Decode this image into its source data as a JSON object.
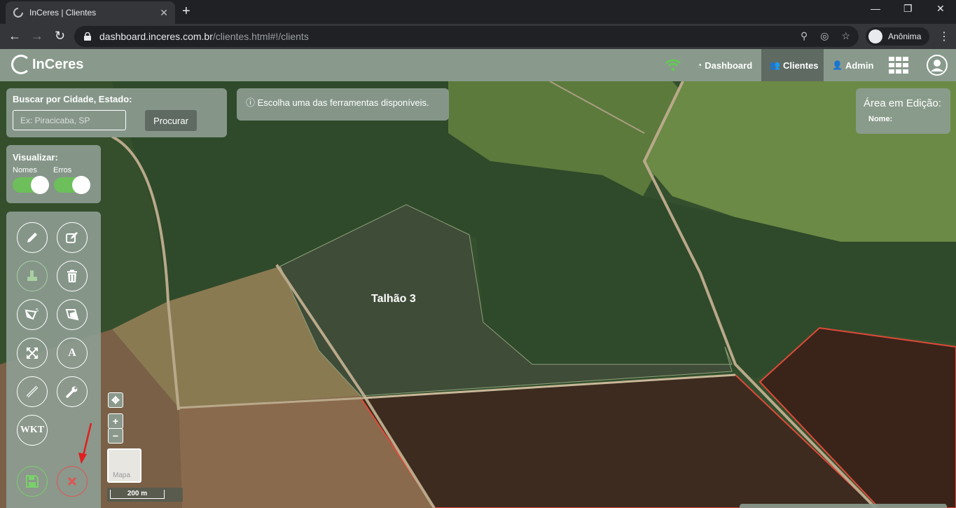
{
  "browser": {
    "tab_title": "InCeres | Clientes",
    "url_host": "dashboard.inceres.com.br",
    "url_path": "/clientes.html#!/clients",
    "profile_label": "Anônima"
  },
  "header": {
    "logo_text": "InCeres",
    "nav": {
      "dashboard": "Dashboard",
      "clients": "Clientes",
      "admin": "Admin"
    },
    "active_nav": "Clientes"
  },
  "search": {
    "label": "Buscar por Cidade, Estado:",
    "placeholder": "Ex: Piracicaba, SP",
    "button": "Procurar"
  },
  "hint": {
    "text": "Escolha uma das ferramentas disponíveis."
  },
  "edit_area": {
    "title": "Área em Edição:",
    "name_label": "Nome:"
  },
  "view": {
    "title": "Visualizar:",
    "names_label": "Nomes",
    "errors_label": "Erros",
    "names_on": true,
    "errors_on": true
  },
  "tools": {
    "wkt_label": "WKT",
    "text_tool_label": "A",
    "icons": [
      "pencil-icon",
      "edit-square-icon",
      "paint-bucket-icon",
      "trash-icon",
      "polygon-cut-icon",
      "polygon-icon",
      "expand-icon",
      "text-icon",
      "ruler-icon",
      "wrench-icon",
      "wkt-icon",
      "save-icon",
      "close-icon"
    ]
  },
  "map": {
    "field_label": "Talhão 3",
    "layer_label": "Mapa",
    "scale_label": "200 m"
  },
  "colors": {
    "header_bg": "#899a8c",
    "panel_bg": "#8c9c90",
    "active_nav": "#5f6b62",
    "toggle_on": "#6cbf5a",
    "danger": "#e05555",
    "wifi": "#5fd04c"
  }
}
